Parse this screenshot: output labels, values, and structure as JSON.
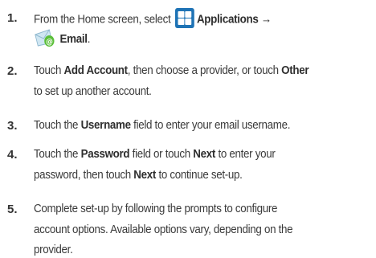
{
  "steps": [
    {
      "number": "1.",
      "pre": "From the Home screen, select",
      "applications": "Applications →",
      "email": "Email",
      "email_suffix": ".",
      "icons": [
        "applications-icon",
        "email-icon"
      ]
    },
    {
      "number": "2.",
      "t1": "Touch ",
      "b1": "Add Account",
      "t2": ", then choose a provider, or touch ",
      "b2": "Other",
      "t3": "to set up another account."
    },
    {
      "number": "3.",
      "t1": "Touch the ",
      "b1": "Username",
      "t2": " field to enter your email username."
    },
    {
      "number": "4.",
      "t1": "Touch the ",
      "b1": "Password",
      "t2": " field or touch ",
      "b2": "Next",
      "t3": " to enter your",
      "t4": "password, then touch ",
      "b3": "Next",
      "t5": " to continue set-up."
    },
    {
      "number": "5.",
      "l1": "Complete set-up by following the prompts to configure",
      "l2": "account options. Available options vary, depending on the",
      "l3": "provider."
    }
  ]
}
